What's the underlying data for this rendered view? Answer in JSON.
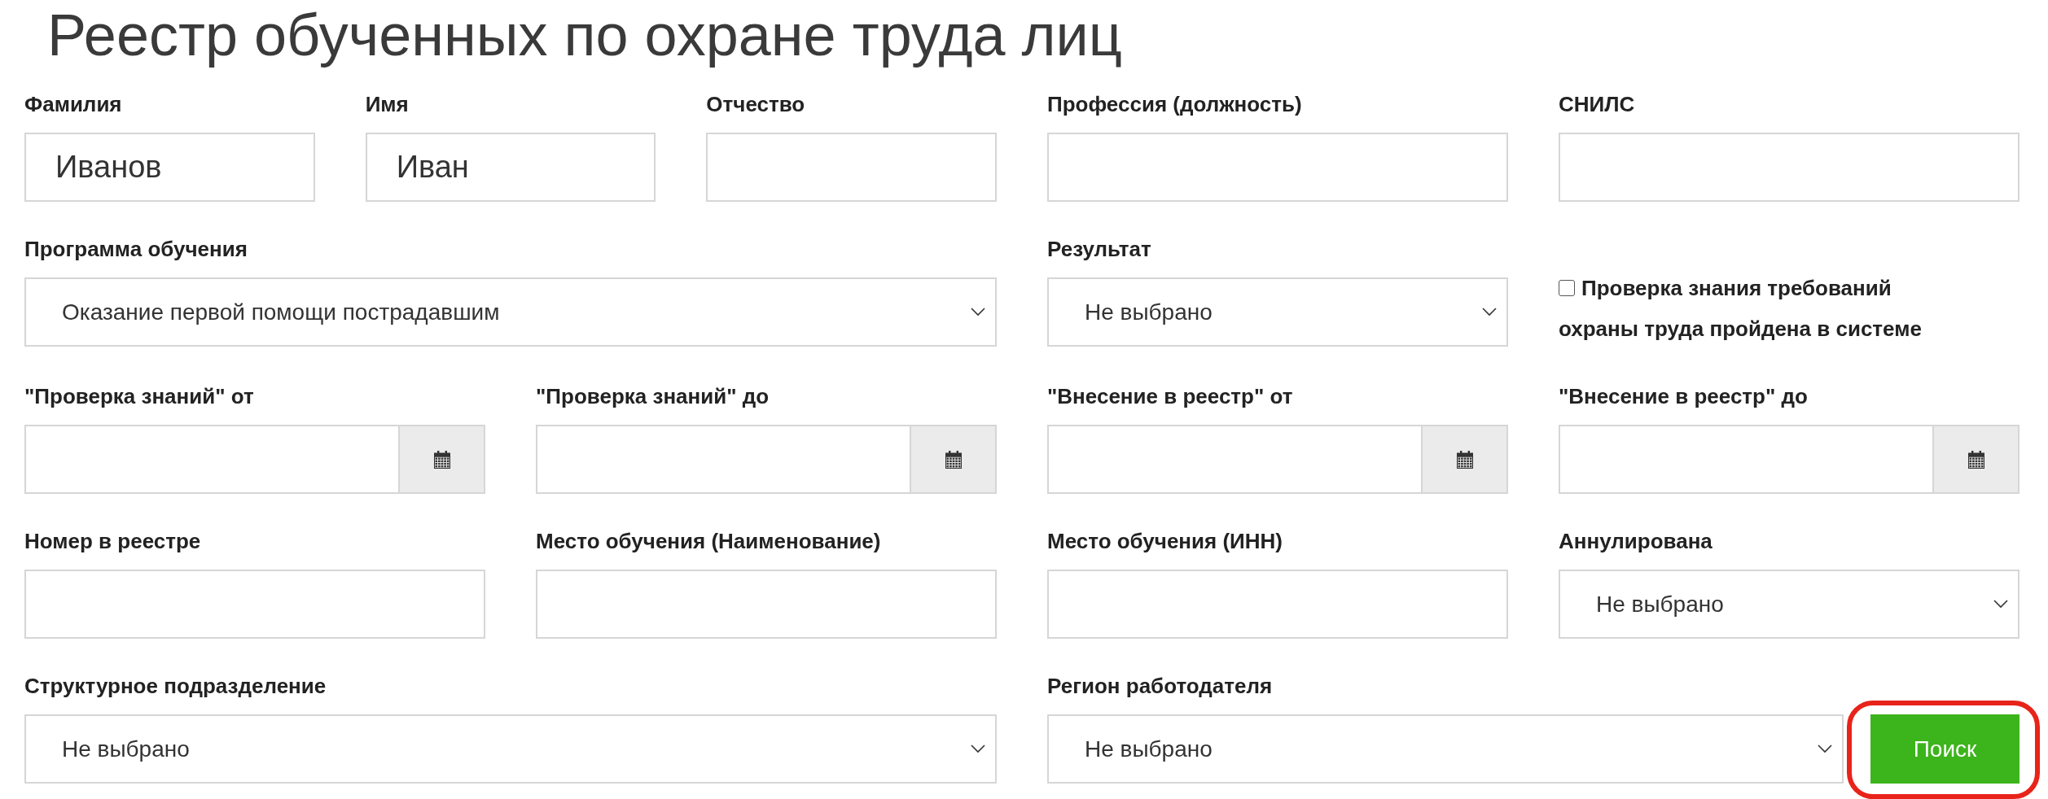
{
  "title": "Реестр обученных по охране труда лиц",
  "person_fields": [
    {
      "label": "Фамилия",
      "value": "Иванов"
    },
    {
      "label": "Имя",
      "value": "Иван"
    },
    {
      "label": "Отчество"
    },
    {
      "label": "Профессия (должность)"
    },
    {
      "label": "СНИЛС"
    }
  ],
  "program": {
    "label": "Программа обучения",
    "value": "Оказание первой помощи пострадавшим"
  },
  "result": {
    "label": "Результат",
    "value": "Не выбрано"
  },
  "system_check": {
    "label": "Проверка знания требований охраны труда пройдена в системе",
    "checked": false
  },
  "date_filters": [
    {
      "label": "\"Проверка знаний\" от"
    },
    {
      "label": "\"Проверка знаний\" до"
    },
    {
      "label": "\"Внесение в реестр\" от"
    },
    {
      "label": "\"Внесение в реестр\" до"
    }
  ],
  "registry_fields": [
    {
      "kind": "text",
      "label": "Номер в реестре"
    },
    {
      "kind": "text",
      "label": "Место обучения (Наименование)"
    },
    {
      "kind": "text",
      "label": "Место обучения (ИНН)"
    },
    {
      "kind": "select",
      "label": "Аннулирована",
      "value": "Не выбрано"
    }
  ],
  "department": {
    "label": "Структурное подразделение",
    "value": "Не выбрано"
  },
  "employer_region": {
    "label": "Регион работодателя",
    "value": "Не выбрано"
  },
  "search_button": {
    "label": "Поиск",
    "highlighted": true
  }
}
